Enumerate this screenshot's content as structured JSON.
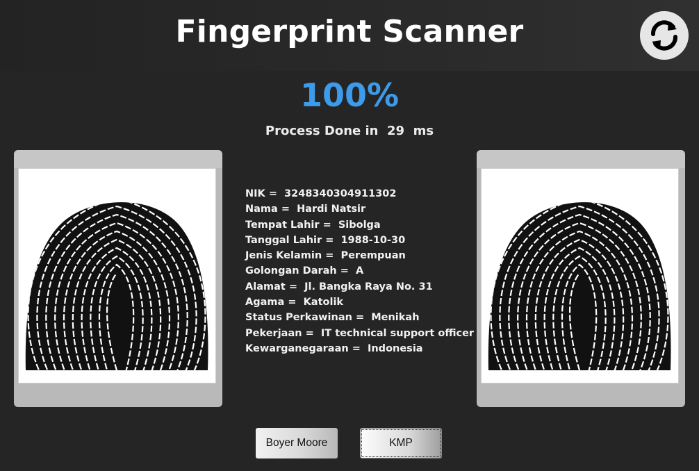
{
  "header": {
    "title": "Fingerprint Scanner",
    "refresh_icon": "refresh-icon"
  },
  "result": {
    "percent": "100%",
    "process_text": "Process Done in  29  ms",
    "progress_value": 100
  },
  "images": {
    "left_icon": "fingerprint-image",
    "right_icon": "fingerprint-image"
  },
  "biodata": {
    "rows": [
      "NIK =  3248340304911302",
      "Nama =  Hardi Natsir",
      "Tempat Lahir =  Sibolga",
      "Tanggal Lahir =  1988-10-30",
      "Jenis Kelamin =  Perempuan",
      "Golongan Darah =  A",
      "Alamat =  Jl. Bangka Raya No. 31",
      "Agama =  Katolik",
      "Status Perkawinan =  Menikah",
      "Pekerjaan =  IT technical support officer",
      "Kewarganegaraan =  Indonesia"
    ]
  },
  "buttons": {
    "boyer_moore": "Boyer Moore",
    "kmp": "KMP"
  },
  "colors": {
    "background": "#252525",
    "accent": "#3d9be9",
    "panel": "#b9b9b9"
  }
}
